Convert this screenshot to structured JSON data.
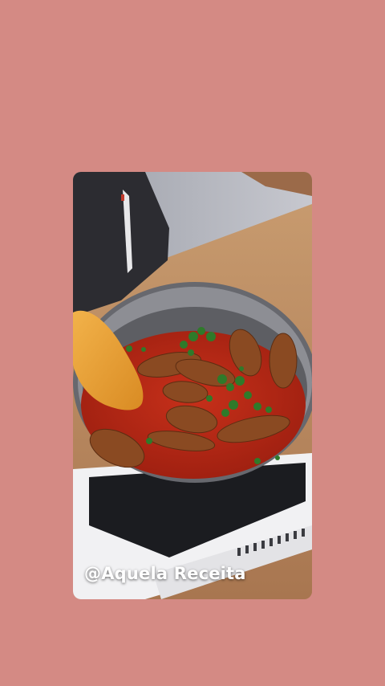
{
  "background_color": "#d48a84",
  "video": {
    "watermark": "@Aquela Receita"
  }
}
